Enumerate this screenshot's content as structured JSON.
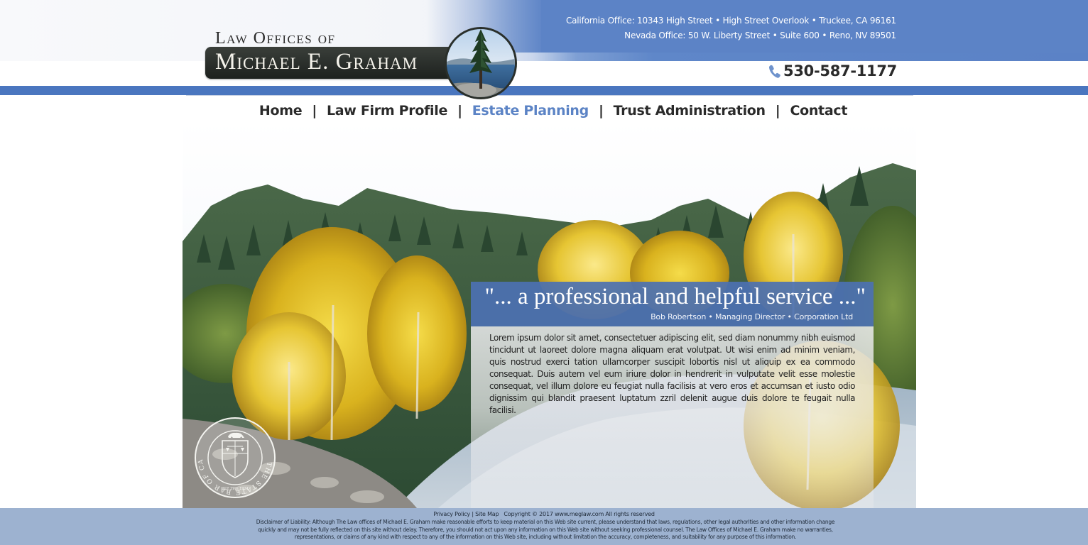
{
  "brand": {
    "line1": "Law Offices of",
    "line2": "Michael E. Graham"
  },
  "offices": {
    "california": "California Office: 10343 High Street • High Street Overlook • Truckee, CA 96161",
    "nevada": "Nevada Office: 50 W. Liberty Street • Suite 600 • Reno, NV 89501"
  },
  "phone": {
    "icon": "phone-icon",
    "number": "530-587-1177"
  },
  "nav": {
    "items": [
      {
        "label": "Home",
        "active": false
      },
      {
        "label": "Law Firm Profile",
        "active": false
      },
      {
        "label": "Estate Planning",
        "active": true
      },
      {
        "label": "Trust Administration",
        "active": false
      },
      {
        "label": "Contact",
        "active": false
      }
    ],
    "separator": "|",
    "active_color": "#5b83c5"
  },
  "testimonial": {
    "quote": "\"... a professional and helpful service ...\"",
    "attribution": "Bob Robertson • Managing Director • Corporation Ltd",
    "body": "Lorem ipsum dolor sit amet, consectetuer adipiscing elit, sed diam nonummy nibh euismod tincidunt ut laoreet dolore magna aliquam erat volutpat. Ut wisi enim ad minim veniam, quis nostrud exerci tation ullamcorper suscipit lobortis nisl ut aliquip ex ea commodo consequat. Duis autem vel eum iriure dolor in hendrerit in vulputate velit esse molestie consequat, vel illum dolore eu feugiat nulla facilisis at vero eros et accumsan et iusto odio dignissim qui blandit praesent luptatum zzril delenit augue duis dolore te feugait nulla facilisi."
  },
  "seal": {
    "icon": "state-bar-seal-icon",
    "ring_text": "THE STATE BAR OF CALIFORNIA",
    "date": "JULY 29th 1927"
  },
  "footer": {
    "privacy": "Privacy Policy",
    "sitemap": "Site Map",
    "divider": "|",
    "copyright": "Copyright © 2017 www.meglaw.com All rights reserved",
    "disclaimer": "Disclaimer of Liability: Although The Law offices of Michael E. Graham make reasonable efforts to keep material on this Web site current, please understand that laws, regulations, other legal authorities and other information change quickly and may not be fully reflected on this site without delay. Therefore, you should not act upon any information on this Web site without seeking professional counsel. The Law Offices of Michael E. Graham make no warranties, representations, or claims of any kind with respect to any of the information on this Web site, including without limitation the accuracy, completeness, and suitability for any purpose of this information."
  },
  "colors": {
    "header_blue": "#5c83c6",
    "bar_blue": "#4a76bf",
    "footer_blue": "#9db2d0",
    "quote_blue": "#4c71b2"
  }
}
